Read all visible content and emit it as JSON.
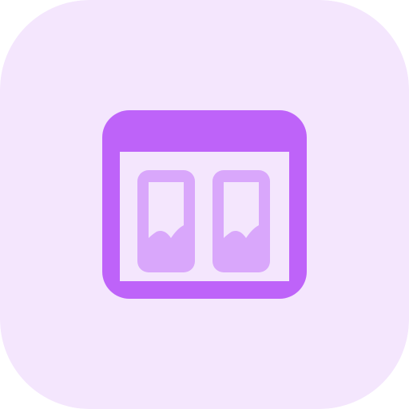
{
  "icon": {
    "name": "browser-window-split-view-icon",
    "colors": {
      "tile_background": "#F4E6FD",
      "window_frame": "#BE63F9",
      "panel_fill": "#D9A7FB",
      "panel_inner": "#F4E6FD"
    }
  }
}
